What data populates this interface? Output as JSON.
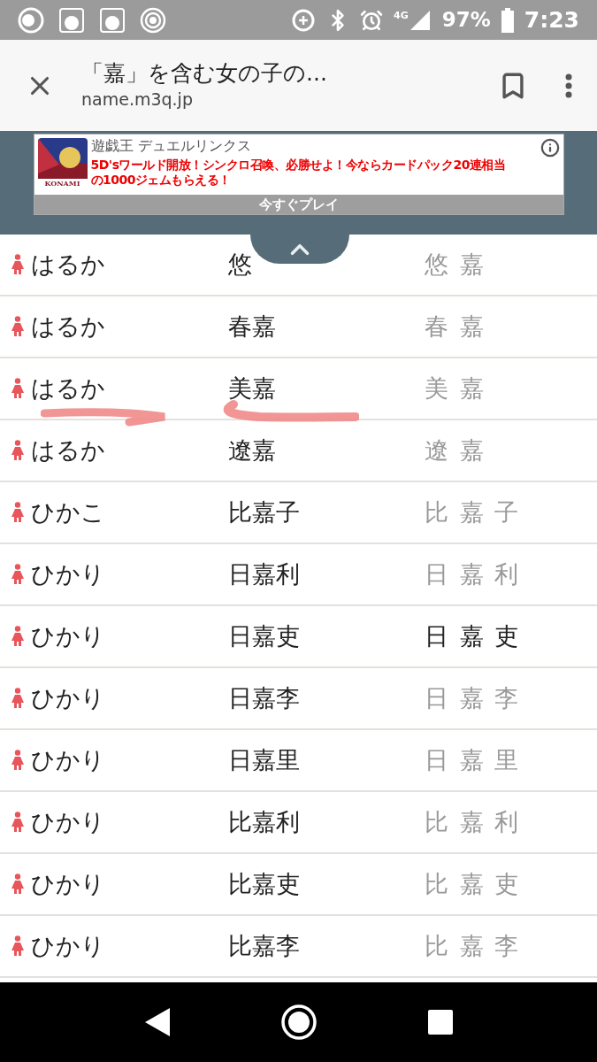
{
  "status_bar": {
    "battery": "97%",
    "time": "7:23",
    "network": "4G"
  },
  "browser": {
    "title": "「嘉」を含む女の子の...",
    "url": "name.m3q.jp"
  },
  "ad": {
    "app_name": "遊戯王 デュエルリンクス",
    "headline": "5D'sワールド開放！シンクロ召喚、必勝せよ！今ならカードパック20連相当の1000ジェムもらえる！",
    "cta": "今すぐプレイ",
    "publisher": "KONAMI"
  },
  "rows": [
    {
      "reading": "はるか",
      "name": "悠",
      "strokes": "悠 嘉",
      "highlighted": false
    },
    {
      "reading": "はるか",
      "name": "春嘉",
      "strokes": "春 嘉",
      "highlighted": false
    },
    {
      "reading": "はるか",
      "name": "美嘉",
      "strokes": "美 嘉",
      "highlighted": false
    },
    {
      "reading": "はるか",
      "name": "遼嘉",
      "strokes": "遼 嘉",
      "highlighted": false
    },
    {
      "reading": "ひかこ",
      "name": "比嘉子",
      "strokes": "比 嘉 子",
      "highlighted": false
    },
    {
      "reading": "ひかり",
      "name": "日嘉利",
      "strokes": "日 嘉 利",
      "highlighted": false
    },
    {
      "reading": "ひかり",
      "name": "日嘉吏",
      "strokes": "日 嘉 吏",
      "highlighted": true
    },
    {
      "reading": "ひかり",
      "name": "日嘉李",
      "strokes": "日 嘉 李",
      "highlighted": false
    },
    {
      "reading": "ひかり",
      "name": "日嘉里",
      "strokes": "日 嘉 里",
      "highlighted": false
    },
    {
      "reading": "ひかり",
      "name": "比嘉利",
      "strokes": "比 嘉 利",
      "highlighted": false
    },
    {
      "reading": "ひかり",
      "name": "比嘉吏",
      "strokes": "比 嘉 吏",
      "highlighted": false
    },
    {
      "reading": "ひかり",
      "name": "比嘉李",
      "strokes": "比 嘉 李",
      "highlighted": false
    }
  ]
}
